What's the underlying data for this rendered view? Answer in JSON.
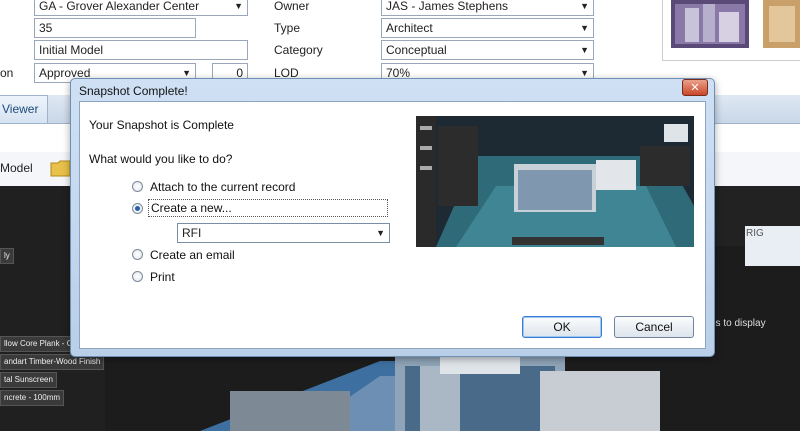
{
  "form": {
    "project_value": "GA - Grover Alexander Center",
    "number_value": "35",
    "name_value": "Initial Model",
    "status_label_partial": "on",
    "status_value": "Approved",
    "counter_value": "0",
    "owner_label": "Owner",
    "owner_value": "JAS - James Stephens",
    "type_label": "Type",
    "type_value": "Architect",
    "category_label": "Category",
    "category_value": "Conceptual",
    "lod_label": "LOD",
    "lod_value": "70%"
  },
  "tabs": {
    "viewer_label": "Viewer"
  },
  "toolbar": {
    "model_label": "Model"
  },
  "viewer": {
    "side_items": [
      "llow Core Plank - G",
      "andart Timber-Wood Finish",
      "tal Sunscreen",
      "ncrete - 100mm"
    ],
    "side_top_tag": "ly",
    "hint_text": "ites to display",
    "right_tag": "RIG"
  },
  "dialog": {
    "title": "Snapshot Complete!",
    "close_glyph": "✕",
    "heading": "Your Snapshot is Complete",
    "question": "What would you like to do?",
    "options": [
      "Attach to the current record",
      "Create a new...",
      "Create an email",
      "Print"
    ],
    "selected_index": 1,
    "create_type_value": "RFI",
    "ok_label": "OK",
    "cancel_label": "Cancel"
  },
  "colors": {
    "accent": "#2a5fa8",
    "dialog_frame": "#b9cfe8",
    "close": "#c9462a"
  }
}
